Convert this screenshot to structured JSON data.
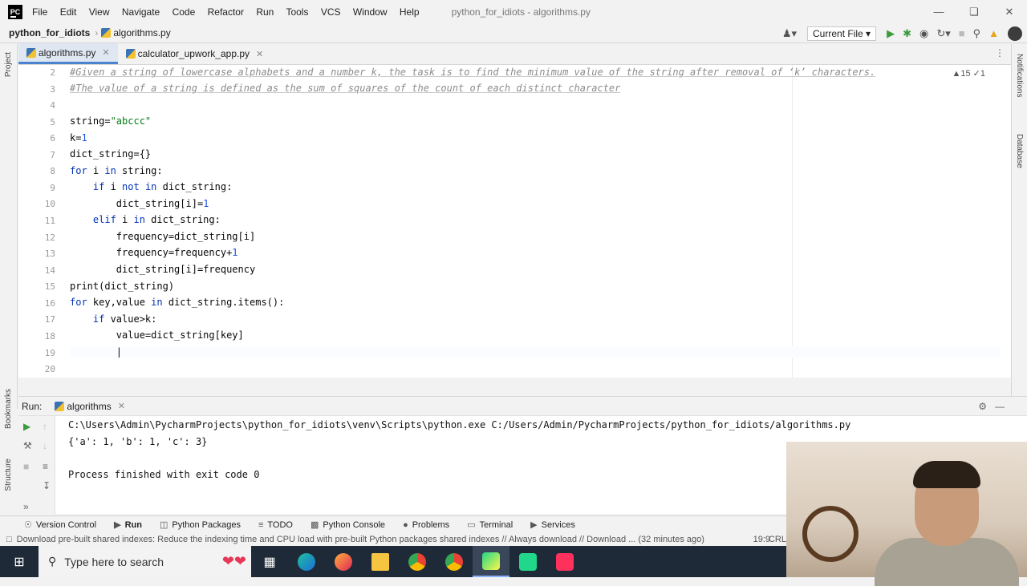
{
  "title_bar": {
    "logo_text": "PC",
    "menu": [
      "File",
      "Edit",
      "View",
      "Navigate",
      "Code",
      "Refactor",
      "Run",
      "Tools",
      "VCS",
      "Window",
      "Help"
    ],
    "window_title": "python_for_idiots - algorithms.py"
  },
  "nav": {
    "project": "python_for_idiots",
    "file": "algorithms.py",
    "run_config": "Current File"
  },
  "left_strip": {
    "project": "Project",
    "bookmarks": "Bookmarks",
    "structure": "Structure"
  },
  "right_strip": {
    "notifications": "Notifications",
    "database": "Database"
  },
  "tabs": [
    {
      "label": "algorithms.py",
      "active": true
    },
    {
      "label": "calculator_upwork_app.py",
      "active": false
    }
  ],
  "editor": {
    "inspections": "▲15 ✓1",
    "line_numbers": [
      "2",
      "3",
      "4",
      "5",
      "6",
      "7",
      "8",
      "9",
      "10",
      "11",
      "12",
      "13",
      "14",
      "15",
      "16",
      "17",
      "18",
      "19",
      "20"
    ],
    "lines": {
      "l2": "#Given a string of lowercase alphabets and a number k, the task is to find the minimum value of the string after removal of ‘k’ characters.",
      "l3": "#The value of a string is defined as the sum of squares of the count of each distinct character",
      "l5a": "string=",
      "l5b": "\"abccc\"",
      "l6a": "k=",
      "l6b": "1",
      "l7": "dict_string={}",
      "l8a": "for",
      "l8b": " i ",
      "l8c": "in",
      "l8d": " string:",
      "l9a": "    if",
      "l9b": " i ",
      "l9c": "not in",
      "l9d": " dict_string:",
      "l10a": "        dict_string[i]=",
      "l10b": "1",
      "l11a": "    elif",
      "l11b": " i ",
      "l11c": "in",
      "l11d": " dict_string:",
      "l12": "        frequency=dict_string[i]",
      "l13a": "        frequency=frequency+",
      "l13b": "1",
      "l14": "        dict_string[i]=frequency",
      "l15": "print(dict_string)",
      "l16a": "for",
      "l16b": " key,value ",
      "l16c": "in",
      "l16d": " dict_string.items():",
      "l17a": "    if",
      "l17b": " value>k:",
      "l18": "        value=dict_string[key]",
      "l19": "        |"
    }
  },
  "run_panel": {
    "label": "Run:",
    "tab": "algorithms",
    "output": [
      "C:\\Users\\Admin\\PycharmProjects\\python_for_idiots\\venv\\Scripts\\python.exe C:/Users/Admin/PycharmProjects/python_for_idiots/algorithms.py",
      "{'a': 1, 'b': 1, 'c': 3}",
      "",
      "Process finished with exit code 0"
    ]
  },
  "bottom_tabs": [
    "Version Control",
    "Run",
    "Python Packages",
    "TODO",
    "Python Console",
    "Problems",
    "Terminal",
    "Services"
  ],
  "status": {
    "message": "Download pre-built shared indexes: Reduce the indexing time and CPU load with pre-built Python packages shared indexes // Always download // Download ... (32 minutes ago)",
    "position": "19:9",
    "line_sep": "CRL"
  },
  "taskbar": {
    "search_placeholder": "Type here to search",
    "apps": [
      "task-view",
      "edge",
      "firefox",
      "file-explorer",
      "chrome",
      "chrome-profile",
      "pycharm",
      "pycharm-ce",
      "jetbrains"
    ]
  }
}
